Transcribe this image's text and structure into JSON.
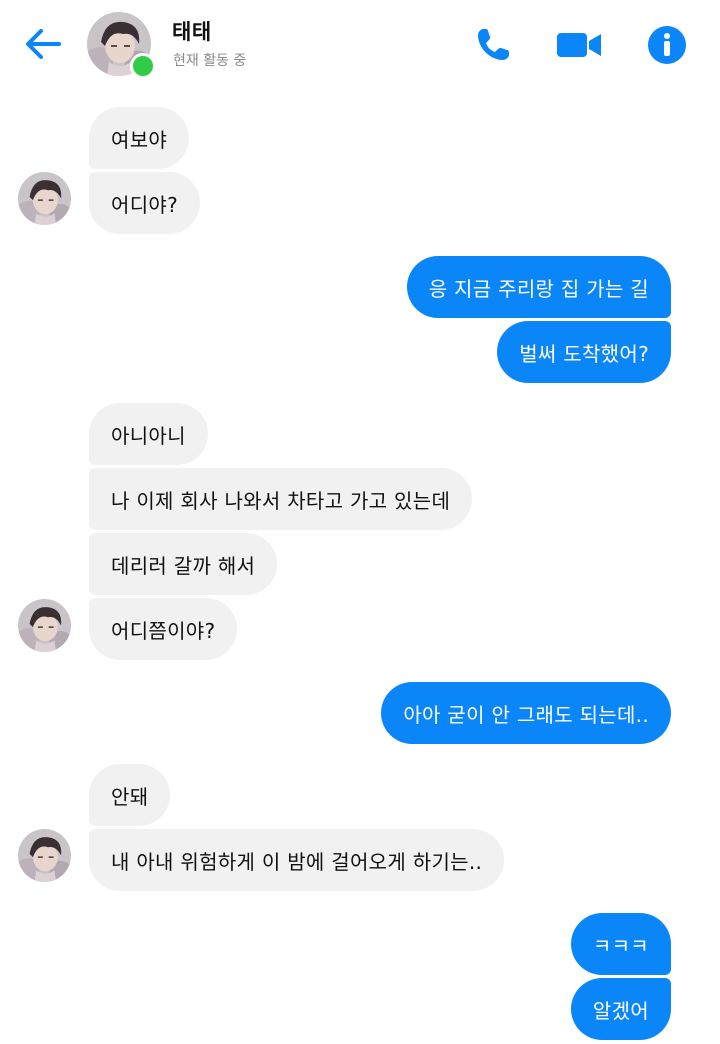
{
  "header": {
    "contact_name": "태태",
    "status_text": "현재 활동 중",
    "back_icon": "back-arrow-icon",
    "call_icon": "phone-icon",
    "video_icon": "video-camera-icon",
    "info_icon": "info-icon"
  },
  "theme": {
    "accent": "#0b86f9",
    "incoming_bg": "#f1f1f1",
    "online": "#31cc46"
  },
  "messages": [
    {
      "sender": "contact",
      "text": "여보야"
    },
    {
      "sender": "contact",
      "text": "어디야?"
    },
    {
      "sender": "me",
      "text": "응 지금 주리랑 집 가는 길"
    },
    {
      "sender": "me",
      "text": "벌써 도착했어?"
    },
    {
      "sender": "contact",
      "text": "아니아니"
    },
    {
      "sender": "contact",
      "text": "나 이제 회사 나와서 차타고 가고 있는데"
    },
    {
      "sender": "contact",
      "text": "데리러 갈까 해서"
    },
    {
      "sender": "contact",
      "text": "어디쯤이야?"
    },
    {
      "sender": "me",
      "text": "아아 굳이 안 그래도 되는데.."
    },
    {
      "sender": "contact",
      "text": "안돼"
    },
    {
      "sender": "contact",
      "text": "내 아내 위험하게 이 밤에 걸어오게 하기는.."
    },
    {
      "sender": "me",
      "text": "ㅋㅋㅋ"
    },
    {
      "sender": "me",
      "text": "알겠어"
    }
  ]
}
